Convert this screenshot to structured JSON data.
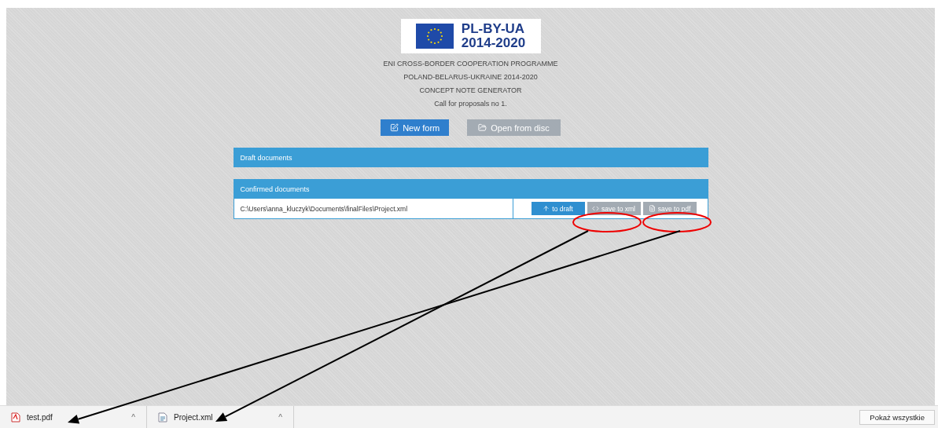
{
  "logo": {
    "title": "PL-BY-UA",
    "years": "2014-2020"
  },
  "heading_lines": [
    "ENI CROSS-BORDER COOPERATION PROGRAMME",
    "POLAND-BELARUS-UKRAINE 2014-2020",
    "CONCEPT NOTE GENERATOR",
    "Call for proposals no 1."
  ],
  "actions": [
    {
      "label": "New form",
      "kind": "new",
      "disabled": false
    },
    {
      "label": "Open from disc",
      "kind": "open",
      "disabled": true
    }
  ],
  "panels": [
    {
      "title": "Draft documents"
    },
    {
      "title": "Confirmed documents",
      "rows": [
        {
          "path": "C:\\Users\\anna_kluczyk\\Documents\\finalFiles\\Project.xml",
          "buttons": [
            {
              "label": "to draft",
              "kind": "draft",
              "disabled": false
            },
            {
              "label": "save to xml",
              "kind": "xml",
              "disabled": true
            },
            {
              "label": "save to pdf",
              "kind": "pdf",
              "disabled": true
            }
          ]
        }
      ]
    }
  ],
  "downloads": [
    {
      "name": "test.pdf",
      "kind": "pdf",
      "caret": "^"
    },
    {
      "name": "Project.xml",
      "kind": "xml",
      "caret": "^"
    }
  ],
  "show_all_button": "Pokaż wszystkie"
}
